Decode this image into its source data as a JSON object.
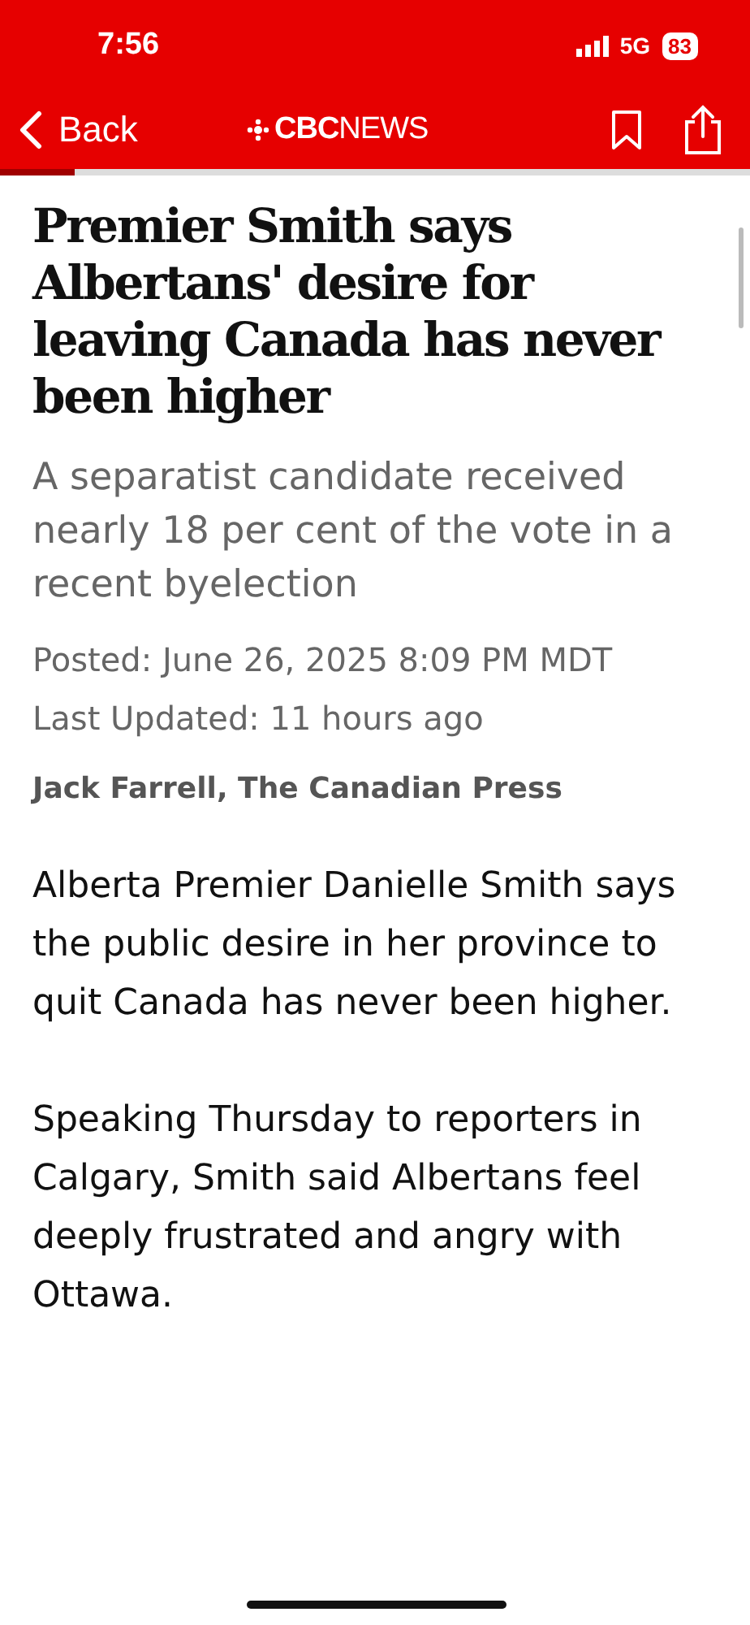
{
  "status_bar": {
    "time": "7:56",
    "network": "5G",
    "battery": "83"
  },
  "nav_bar": {
    "back": "Back",
    "logo": "CBCNEWS",
    "reading_progress": {
      "level": 0.1
    }
  },
  "article": {
    "headline": "Premier Smith says Albertans' desire for leaving Canada has never been higher",
    "dek": "A separatist candidate received nearly 18 per cent of the vote in a recent byelection",
    "posted": "Posted: June 26, 2025 8:09 PM MDT",
    "updated": "Last Updated: 11 hours ago",
    "byline": "Jack Farrell, The Canadian Press",
    "paragraphs": [
      "Alberta Premier Danielle Smith says the public desire in her province to quit Canada has never been higher.",
      "Speaking Thursday to reporters in Calgary, Smith said Albertans feel deeply frustrated and angry with Ottawa."
    ]
  }
}
